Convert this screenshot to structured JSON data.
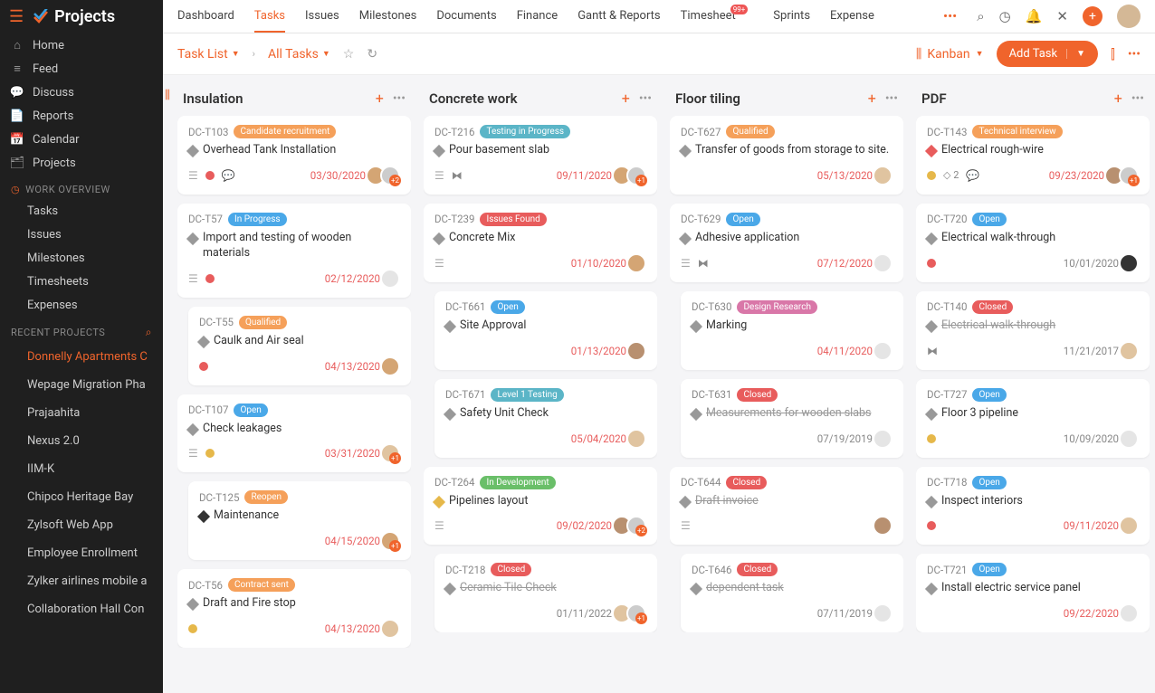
{
  "app_name": "Projects",
  "sidebar_main": [
    {
      "icon": "⌂",
      "label": "Home"
    },
    {
      "icon": "≡",
      "label": "Feed"
    },
    {
      "icon": "💬",
      "label": "Discuss"
    },
    {
      "icon": "📄",
      "label": "Reports"
    },
    {
      "icon": "📅",
      "label": "Calendar"
    },
    {
      "icon": "🗂",
      "label": "Projects"
    }
  ],
  "work_overview_label": "WORK OVERVIEW",
  "work_overview": [
    {
      "label": "Tasks"
    },
    {
      "label": "Issues"
    },
    {
      "label": "Milestones"
    },
    {
      "label": "Timesheets"
    },
    {
      "label": "Expenses"
    }
  ],
  "recent_label": "RECENT PROJECTS",
  "recent": [
    {
      "label": "Donnelly Apartments C",
      "active": true
    },
    {
      "label": "Wepage Migration Pha"
    },
    {
      "label": "Prajaahita"
    },
    {
      "label": "Nexus 2.0"
    },
    {
      "label": "IIM-K"
    },
    {
      "label": "Chipco Heritage Bay"
    },
    {
      "label": "Zylsoft Web App"
    },
    {
      "label": "Employee Enrollment"
    },
    {
      "label": "Zylker airlines mobile a"
    },
    {
      "label": "Collaboration Hall Con"
    }
  ],
  "top_nav": [
    {
      "label": "Dashboard"
    },
    {
      "label": "Tasks",
      "active": true
    },
    {
      "label": "Issues"
    },
    {
      "label": "Milestones"
    },
    {
      "label": "Documents"
    },
    {
      "label": "Finance"
    },
    {
      "label": "Gantt & Reports"
    },
    {
      "label": "Timesheet",
      "badge": "99+"
    },
    {
      "label": "Sprints"
    },
    {
      "label": "Expense"
    }
  ],
  "breadcrumb": {
    "task_list": "Task List",
    "all_tasks": "All Tasks"
  },
  "view_toggle": "Kanban",
  "add_task_label": "Add Task",
  "columns": [
    {
      "title": "Insulation",
      "cards": [
        {
          "id": "DC-T103",
          "tag": "Candidate recruitment",
          "tagc": "orange",
          "d": "gray",
          "title": "Overhead Tank Installation",
          "left": [
            "stack",
            "dot-red",
            "chat"
          ],
          "date": "03/30/2020",
          "av": [
            {
              "c": "#d4a574"
            },
            {
              "c": "#ccc",
              "badge": "+2"
            }
          ]
        },
        {
          "id": "DC-T57",
          "tag": "In Progress",
          "tagc": "blue",
          "d": "gray",
          "title": "Import and testing of wooden materials",
          "left": [
            "stack",
            "dot-red"
          ],
          "date": "02/12/2020",
          "av": [
            {
              "empty": true
            }
          ]
        },
        {
          "id": "DC-T55",
          "tag": "Qualified",
          "tagc": "orange",
          "d": "gray",
          "title": "Caulk and Air seal",
          "left": [
            "dot-red"
          ],
          "date": "04/13/2020",
          "av": [
            {
              "c": "#d4a574"
            }
          ],
          "indent": 1
        },
        {
          "id": "DC-T107",
          "tag": "Open",
          "tagc": "blue",
          "d": "gray",
          "title": "Check leakages",
          "left": [
            "stack",
            "dot-yellow"
          ],
          "date": "03/31/2020",
          "av": [
            {
              "c": "#e0c4a0",
              "badge": "+1"
            }
          ]
        },
        {
          "id": "DC-T125",
          "tag": "Reopen",
          "tagc": "orange",
          "d": "dark",
          "title": "Maintenance",
          "left": [],
          "date": "04/15/2020",
          "av": [
            {
              "c": "#d4a574",
              "badge": "+1"
            }
          ],
          "indent": 1
        },
        {
          "id": "DC-T56",
          "tag": "Contract sent",
          "tagc": "orange",
          "d": "gray",
          "title": "Draft and Fire stop",
          "left": [
            "dot-yellow"
          ],
          "date": "04/13/2020",
          "av": [
            {
              "c": "#e0c4a0"
            }
          ]
        }
      ]
    },
    {
      "title": "Concrete work",
      "cards": [
        {
          "id": "DC-T216",
          "tag": "Testing in Progress",
          "tagc": "cyan",
          "d": "gray",
          "title": "Pour basement slab",
          "left": [
            "stack",
            "bug"
          ],
          "date": "09/11/2020",
          "av": [
            {
              "c": "#d4a574"
            },
            {
              "c": "#ccc",
              "badge": "+1"
            }
          ]
        },
        {
          "id": "DC-T239",
          "tag": "Issues Found",
          "tagc": "red",
          "d": "gray",
          "title": "Concrete Mix",
          "left": [
            "stack"
          ],
          "date": "01/10/2020",
          "av": [
            {
              "c": "#d4a574"
            }
          ]
        },
        {
          "id": "DC-T661",
          "tag": "Open",
          "tagc": "blue",
          "d": "gray",
          "title": "Site Approval",
          "left": [],
          "date": "01/13/2020",
          "av": [
            {
              "c": "#b89070"
            }
          ],
          "indent": 1
        },
        {
          "id": "DC-T671",
          "tag": "Level 1 Testing",
          "tagc": "cyan",
          "d": "gray",
          "title": "Safety Unit Check",
          "left": [],
          "date": "05/04/2020",
          "av": [
            {
              "c": "#e0c4a0"
            }
          ],
          "indent": 1
        },
        {
          "id": "DC-T264",
          "tag": "In Development",
          "tagc": "green",
          "d": "yellow",
          "title": "Pipelines layout",
          "left": [
            "stack"
          ],
          "date": "09/02/2020",
          "av": [
            {
              "c": "#b89070"
            },
            {
              "c": "#ccc",
              "badge": "+2"
            }
          ]
        },
        {
          "id": "DC-T218",
          "tag": "Closed",
          "tagc": "red",
          "d": "gray",
          "title": "Ceramic Tile Check",
          "strike": true,
          "left": [],
          "date": "01/11/2022",
          "dg": true,
          "av": [
            {
              "c": "#e0c4a0"
            },
            {
              "c": "#ccc",
              "badge": "+1"
            }
          ],
          "indent": 1
        }
      ]
    },
    {
      "title": "Floor tiling",
      "cards": [
        {
          "id": "DC-T627",
          "tag": "Qualified",
          "tagc": "orange",
          "d": "gray",
          "title": "Transfer of goods from storage to site.",
          "left": [],
          "date": "05/13/2020",
          "av": [
            {
              "c": "#e0c4a0"
            }
          ]
        },
        {
          "id": "DC-T629",
          "tag": "Open",
          "tagc": "blue",
          "d": "gray",
          "title": "Adhesive application",
          "left": [
            "stack",
            "bug"
          ],
          "date": "07/12/2020",
          "av": [
            {
              "empty": true
            }
          ]
        },
        {
          "id": "DC-T630",
          "tag": "Design Research",
          "tagc": "pink",
          "d": "gray",
          "title": "Marking",
          "left": [],
          "date": "04/11/2020",
          "av": [
            {
              "empty": true
            }
          ],
          "indent": 1
        },
        {
          "id": "DC-T631",
          "tag": "Closed",
          "tagc": "red",
          "d": "gray",
          "title": "Measurements for wooden slabs",
          "strike": true,
          "left": [],
          "date": "07/19/2019",
          "dg": true,
          "av": [
            {
              "empty": true
            }
          ],
          "indent": 1
        },
        {
          "id": "DC-T644",
          "tag": "Closed",
          "tagc": "red",
          "d": "gray",
          "title": "Draft invoice",
          "strike": true,
          "left": [
            "stack"
          ],
          "date": "",
          "av": [
            {
              "c": "#b89070"
            }
          ]
        },
        {
          "id": "DC-T646",
          "tag": "Closed",
          "tagc": "red",
          "d": "gray",
          "title": "dependent task",
          "strike": true,
          "left": [],
          "date": "07/11/2019",
          "dg": true,
          "av": [
            {
              "empty": true
            }
          ],
          "indent": 1
        }
      ]
    },
    {
      "title": "PDF",
      "cards": [
        {
          "id": "DC-T143",
          "tag": "Technical interview",
          "tagc": "orange",
          "d": "red",
          "title": "Electrical rough-wire",
          "left": [
            "dot-yellow",
            "tag2",
            "chat"
          ],
          "date": "09/23/2020",
          "av": [
            {
              "c": "#b89070"
            },
            {
              "c": "#ccc",
              "badge": "+1"
            }
          ]
        },
        {
          "id": "DC-T720",
          "tag": "Open",
          "tagc": "blue",
          "d": "gray",
          "title": "Electrical walk-through",
          "left": [
            "dot-red"
          ],
          "date": "10/01/2020",
          "dg": true,
          "av": [
            {
              "c": "#333"
            }
          ]
        },
        {
          "id": "DC-T140",
          "tag": "Closed",
          "tagc": "red",
          "d": "gray",
          "title": "Electrical walk-through",
          "strike": true,
          "left": [
            "bug"
          ],
          "date": "11/21/2017",
          "dg": true,
          "av": [
            {
              "c": "#e0c4a0"
            }
          ]
        },
        {
          "id": "DC-T727",
          "tag": "Open",
          "tagc": "blue",
          "d": "gray",
          "title": "Floor 3 pipeline",
          "left": [
            "dot-yellow"
          ],
          "date": "10/09/2020",
          "dg": true,
          "av": [
            {
              "empty": true
            }
          ]
        },
        {
          "id": "DC-T718",
          "tag": "Open",
          "tagc": "blue",
          "d": "gray",
          "title": "Inspect interiors",
          "left": [
            "dot-red"
          ],
          "date": "09/11/2020",
          "av": [
            {
              "c": "#e0c4a0"
            }
          ]
        },
        {
          "id": "DC-T721",
          "tag": "Open",
          "tagc": "blue",
          "d": "gray",
          "title": "Install electric service panel",
          "left": [],
          "date": "09/22/2020",
          "av": [
            {
              "empty": true
            }
          ]
        }
      ]
    }
  ]
}
